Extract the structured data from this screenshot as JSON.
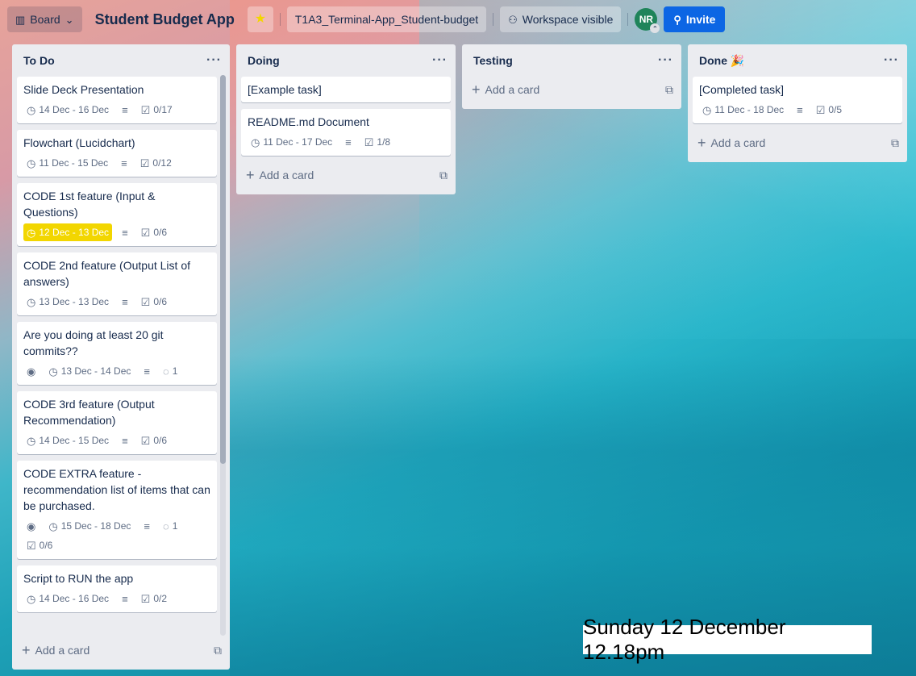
{
  "topbar": {
    "board_label": "Board",
    "board_title": "Student Budget App",
    "workspace_name": "T1A3_Terminal-App_Student-budget",
    "visibility": "Workspace visible",
    "avatar_initials": "NR",
    "invite_label": "Invite"
  },
  "lists": [
    {
      "title": "To Do",
      "cards": [
        {
          "title": "Slide Deck Presentation",
          "dates": "14 Dec - 16 Dec",
          "checklist": "0/17"
        },
        {
          "title": "Flowchart (Lucidchart)",
          "dates": "11 Dec - 15 Dec",
          "checklist": "0/12"
        },
        {
          "title": "CODE 1st feature (Input & Questions)",
          "dates": "12 Dec - 13 Dec",
          "checklist": "0/6"
        },
        {
          "title": "CODE 2nd feature (Output List of answers)",
          "dates": "13 Dec - 13 Dec",
          "checklist": "0/6"
        },
        {
          "title": "Are you doing at least 20 git commits??",
          "dates": "13 Dec - 14 Dec",
          "comments": "1"
        },
        {
          "title": "CODE 3rd feature (Output Recommendation)",
          "dates": "14 Dec - 15 Dec",
          "checklist": "0/6"
        },
        {
          "title": "CODE EXTRA feature - recommendation list of items that can be purchased.",
          "dates": "15 Dec - 18 Dec",
          "comments": "1",
          "checklist": "0/6"
        },
        {
          "title": "Script to RUN the app",
          "dates": "14 Dec - 16 Dec",
          "checklist": "0/2"
        }
      ],
      "add_label": "Add a card"
    },
    {
      "title": "Doing",
      "cards": [
        {
          "title": "[Example task]"
        },
        {
          "title": "README.md Document",
          "dates": "11 Dec - 17 Dec",
          "checklist": "1/8"
        }
      ],
      "add_label": "Add a card"
    },
    {
      "title": "Testing",
      "cards": [],
      "add_label": "Add a card"
    },
    {
      "title": "Done 🎉",
      "cards": [
        {
          "title": "[Completed task]",
          "dates": "11 Dec - 18 Dec",
          "checklist": "0/5"
        }
      ],
      "add_label": "Add a card"
    }
  ],
  "overlay_timestamp": "Sunday 12 December 12.18pm",
  "colors": {
    "due_soon": "#f2d600",
    "invite": "#0c66e4",
    "avatar": "#1f845a"
  }
}
